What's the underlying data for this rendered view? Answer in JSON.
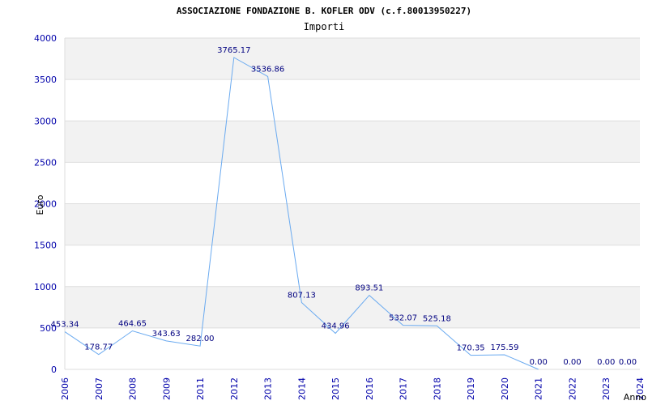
{
  "chart_data": {
    "type": "line",
    "title": "ASSOCIAZIONE FONDAZIONE B. KOFLER ODV (c.f.80013950227)",
    "subtitle": "Importi",
    "xlabel": "Anno",
    "ylabel": "Euro",
    "ylim": [
      0,
      4000
    ],
    "yticks": [
      "0",
      "500",
      "1000",
      "1500",
      "2000",
      "2500",
      "3000",
      "3500",
      "4000"
    ],
    "yticks_values": [
      0,
      500,
      1000,
      1500,
      2000,
      2500,
      3000,
      3500,
      4000
    ],
    "categories": [
      "2006",
      "2007",
      "2008",
      "2009",
      "2011",
      "2012",
      "2013",
      "2014",
      "2015",
      "2016",
      "2017",
      "2018",
      "2019",
      "2020",
      "2021",
      "2022",
      "2023",
      "2024"
    ],
    "values": [
      453.34,
      178.77,
      464.65,
      343.63,
      282.0,
      3765.17,
      3536.86,
      807.13,
      434.96,
      893.51,
      532.07,
      525.18,
      170.35,
      175.59,
      0.0,
      0.0,
      0.0,
      0.0
    ],
    "data_labels": [
      "453.34",
      "178.77",
      "464.65",
      "343.63",
      "282.00",
      "3765.17",
      "3536.86",
      "807.13",
      "434.96",
      "893.51",
      "532.07",
      "525.18",
      "170.35",
      "175.59",
      "0.00",
      "0.00",
      "0.00",
      "0.00"
    ],
    "line_points": 15,
    "grid": true,
    "colors": {
      "line": "#6aaaf0",
      "band": "#f2f2f2",
      "tick": "#0000aa",
      "label": "#000080",
      "grid": "#dddddd"
    }
  }
}
